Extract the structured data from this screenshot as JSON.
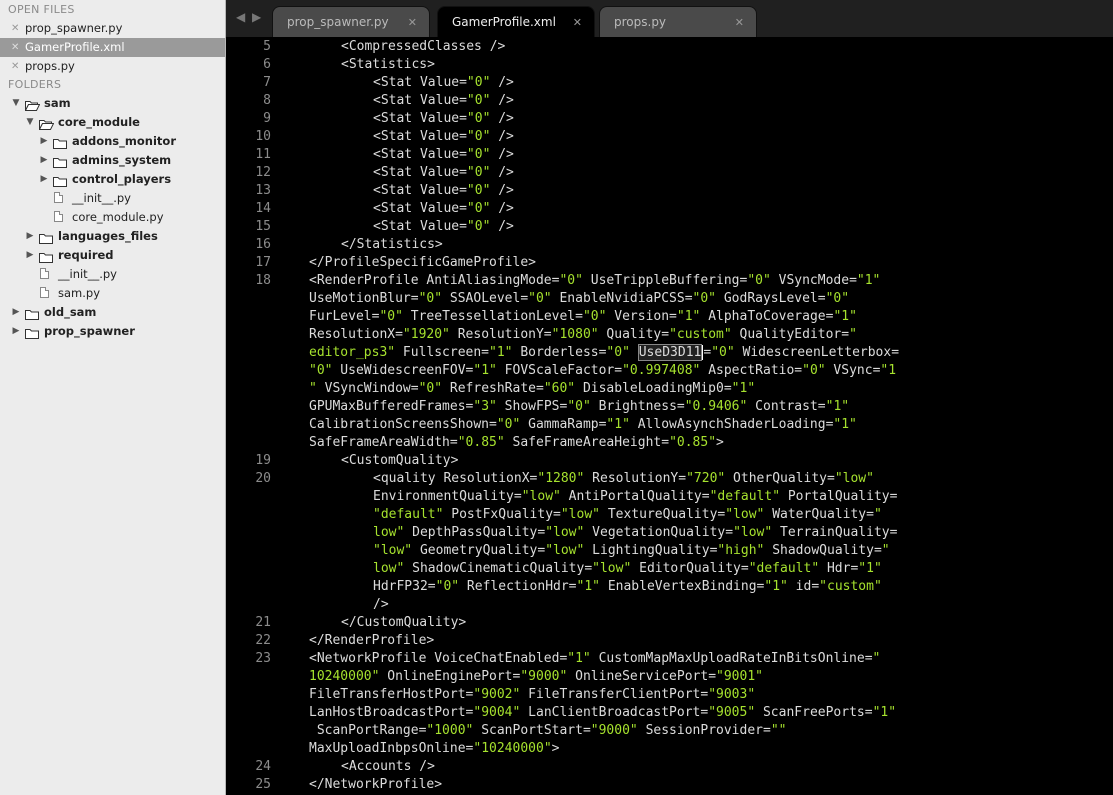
{
  "sidebar": {
    "open_files_header": "OPEN FILES",
    "folders_header": "FOLDERS",
    "open_files": [
      {
        "name": "prop_spawner.py",
        "selected": false
      },
      {
        "name": "GamerProfile.xml",
        "selected": true
      },
      {
        "name": "props.py",
        "selected": false
      }
    ],
    "tree": [
      {
        "label": "sam",
        "kind": "folder",
        "open": true,
        "depth": 0,
        "bold": true
      },
      {
        "label": "core_module",
        "kind": "folder",
        "open": true,
        "depth": 1,
        "bold": true
      },
      {
        "label": "addons_monitor",
        "kind": "folder",
        "open": false,
        "depth": 2,
        "bold": true
      },
      {
        "label": "admins_system",
        "kind": "folder",
        "open": false,
        "depth": 2,
        "bold": true
      },
      {
        "label": "control_players",
        "kind": "folder",
        "open": false,
        "depth": 2,
        "bold": true
      },
      {
        "label": "__init__.py",
        "kind": "file",
        "depth": 2,
        "bold": false
      },
      {
        "label": "core_module.py",
        "kind": "file",
        "depth": 2,
        "bold": false
      },
      {
        "label": "languages_files",
        "kind": "folder",
        "open": false,
        "depth": 1,
        "bold": true
      },
      {
        "label": "required",
        "kind": "folder",
        "open": false,
        "depth": 1,
        "bold": true
      },
      {
        "label": "__init__.py",
        "kind": "file",
        "depth": 1,
        "bold": false
      },
      {
        "label": "sam.py",
        "kind": "file",
        "depth": 1,
        "bold": false
      },
      {
        "label": "old_sam",
        "kind": "folder",
        "open": false,
        "depth": 0,
        "bold": true
      },
      {
        "label": "prop_spawner",
        "kind": "folder",
        "open": false,
        "depth": 0,
        "bold": true
      }
    ]
  },
  "tabs": [
    {
      "label": "prop_spawner.py",
      "active": false,
      "close": "✕"
    },
    {
      "label": "GamerProfile.xml",
      "active": true,
      "close": "✕"
    },
    {
      "label": "props.py",
      "active": false,
      "close": "✕"
    }
  ],
  "colors": {
    "tag": "#dcdcdc",
    "string": "#a6e22e",
    "line_number": "#8c8c8c",
    "background": "#000000"
  },
  "editor": {
    "lines": [
      {
        "n": "5",
        "indent": 2,
        "segs": [
          [
            "t",
            "<CompressedClasses />"
          ]
        ]
      },
      {
        "n": "6",
        "indent": 2,
        "segs": [
          [
            "t",
            "<Statistics>"
          ]
        ]
      },
      {
        "n": "7",
        "indent": 4,
        "segs": [
          [
            "t",
            "<Stat Value="
          ],
          [
            "s",
            "\"0\""
          ],
          [
            "t",
            " />"
          ]
        ]
      },
      {
        "n": "8",
        "indent": 4,
        "segs": [
          [
            "t",
            "<Stat Value="
          ],
          [
            "s",
            "\"0\""
          ],
          [
            "t",
            " />"
          ]
        ]
      },
      {
        "n": "9",
        "indent": 4,
        "segs": [
          [
            "t",
            "<Stat Value="
          ],
          [
            "s",
            "\"0\""
          ],
          [
            "t",
            " />"
          ]
        ]
      },
      {
        "n": "10",
        "indent": 4,
        "segs": [
          [
            "t",
            "<Stat Value="
          ],
          [
            "s",
            "\"0\""
          ],
          [
            "t",
            " />"
          ]
        ]
      },
      {
        "n": "11",
        "indent": 4,
        "segs": [
          [
            "t",
            "<Stat Value="
          ],
          [
            "s",
            "\"0\""
          ],
          [
            "t",
            " />"
          ]
        ]
      },
      {
        "n": "12",
        "indent": 4,
        "segs": [
          [
            "t",
            "<Stat Value="
          ],
          [
            "s",
            "\"0\""
          ],
          [
            "t",
            " />"
          ]
        ]
      },
      {
        "n": "13",
        "indent": 4,
        "segs": [
          [
            "t",
            "<Stat Value="
          ],
          [
            "s",
            "\"0\""
          ],
          [
            "t",
            " />"
          ]
        ]
      },
      {
        "n": "14",
        "indent": 4,
        "segs": [
          [
            "t",
            "<Stat Value="
          ],
          [
            "s",
            "\"0\""
          ],
          [
            "t",
            " />"
          ]
        ]
      },
      {
        "n": "15",
        "indent": 4,
        "segs": [
          [
            "t",
            "<Stat Value="
          ],
          [
            "s",
            "\"0\""
          ],
          [
            "t",
            " />"
          ]
        ]
      },
      {
        "n": "16",
        "indent": 2,
        "segs": [
          [
            "t",
            "</Statistics>"
          ]
        ]
      },
      {
        "n": "17",
        "indent": 0,
        "segs": [
          [
            "t",
            "</ProfileSpecificGameProfile>"
          ]
        ]
      },
      {
        "n": "18",
        "indent": 0,
        "current": true,
        "segs": [
          [
            "t",
            "<RenderProfile AntiAliasingMode="
          ],
          [
            "s",
            "\"0\""
          ],
          [
            "t",
            " UseTrippleBuffering="
          ],
          [
            "s",
            "\"0\""
          ],
          [
            "t",
            " VSyncMode="
          ],
          [
            "s",
            "\"1\""
          ]
        ]
      },
      {
        "n": "",
        "indent": 0,
        "current": true,
        "segs": [
          [
            "t",
            "UseMotionBlur="
          ],
          [
            "s",
            "\"0\""
          ],
          [
            "t",
            " SSAOLevel="
          ],
          [
            "s",
            "\"0\""
          ],
          [
            "t",
            " EnableNvidiaPCSS="
          ],
          [
            "s",
            "\"0\""
          ],
          [
            "t",
            " GodRaysLevel="
          ],
          [
            "s",
            "\"0\""
          ]
        ]
      },
      {
        "n": "",
        "indent": 0,
        "current": true,
        "segs": [
          [
            "t",
            "FurLevel="
          ],
          [
            "s",
            "\"0\""
          ],
          [
            "t",
            " TreeTessellationLevel="
          ],
          [
            "s",
            "\"0\""
          ],
          [
            "t",
            " Version="
          ],
          [
            "s",
            "\"1\""
          ],
          [
            "t",
            " AlphaToCoverage="
          ],
          [
            "s",
            "\"1\""
          ]
        ]
      },
      {
        "n": "",
        "indent": 0,
        "current": true,
        "segs": [
          [
            "t",
            "ResolutionX="
          ],
          [
            "s",
            "\"1920\""
          ],
          [
            "t",
            " ResolutionY="
          ],
          [
            "s",
            "\"1080\""
          ],
          [
            "t",
            " Quality="
          ],
          [
            "s",
            "\"custom\""
          ],
          [
            "t",
            " QualityEditor="
          ],
          [
            "s",
            "\""
          ]
        ]
      },
      {
        "n": "",
        "indent": 0,
        "current": true,
        "segs": [
          [
            "s",
            "editor_ps3\""
          ],
          [
            "t",
            " Fullscreen="
          ],
          [
            "s",
            "\"1\""
          ],
          [
            "t",
            " Borderless="
          ],
          [
            "s",
            "\"0\""
          ],
          [
            "t",
            " "
          ],
          [
            "h",
            "UseD3D11"
          ],
          [
            "c",
            ""
          ],
          [
            "t",
            "="
          ],
          [
            "s",
            "\"0\""
          ],
          [
            "t",
            " WidescreenLetterbox="
          ]
        ]
      },
      {
        "n": "",
        "indent": 0,
        "current": true,
        "segs": [
          [
            "s",
            "\"0\""
          ],
          [
            "t",
            " UseWidescreenFOV="
          ],
          [
            "s",
            "\"1\""
          ],
          [
            "t",
            " FOVScaleFactor="
          ],
          [
            "s",
            "\"0.997408\""
          ],
          [
            "t",
            " AspectRatio="
          ],
          [
            "s",
            "\"0\""
          ],
          [
            "t",
            " VSync="
          ],
          [
            "s",
            "\"1"
          ]
        ]
      },
      {
        "n": "",
        "indent": 0,
        "current": true,
        "segs": [
          [
            "s",
            "\""
          ],
          [
            "t",
            " VSyncWindow="
          ],
          [
            "s",
            "\"0\""
          ],
          [
            "t",
            " RefreshRate="
          ],
          [
            "s",
            "\"60\""
          ],
          [
            "t",
            " DisableLoadingMip0="
          ],
          [
            "s",
            "\"1\""
          ]
        ]
      },
      {
        "n": "",
        "indent": 0,
        "current": true,
        "segs": [
          [
            "t",
            "GPUMaxBufferedFrames="
          ],
          [
            "s",
            "\"3\""
          ],
          [
            "t",
            " ShowFPS="
          ],
          [
            "s",
            "\"0\""
          ],
          [
            "t",
            " Brightness="
          ],
          [
            "s",
            "\"0.9406\""
          ],
          [
            "t",
            " Contrast="
          ],
          [
            "s",
            "\"1\""
          ]
        ]
      },
      {
        "n": "",
        "indent": 0,
        "current": true,
        "segs": [
          [
            "t",
            "CalibrationScreensShown="
          ],
          [
            "s",
            "\"0\""
          ],
          [
            "t",
            " GammaRamp="
          ],
          [
            "s",
            "\"1\""
          ],
          [
            "t",
            " AllowAsynchShaderLoading="
          ],
          [
            "s",
            "\"1\""
          ]
        ]
      },
      {
        "n": "",
        "indent": 0,
        "current": true,
        "segs": [
          [
            "t",
            "SafeFrameAreaWidth="
          ],
          [
            "s",
            "\"0.85\""
          ],
          [
            "t",
            " SafeFrameAreaHeight="
          ],
          [
            "s",
            "\"0.85\""
          ],
          [
            "t",
            ">"
          ]
        ]
      },
      {
        "n": "19",
        "indent": 2,
        "segs": [
          [
            "t",
            "<CustomQuality>"
          ]
        ]
      },
      {
        "n": "20",
        "indent": 4,
        "segs": [
          [
            "t",
            "<quality ResolutionX="
          ],
          [
            "s",
            "\"1280\""
          ],
          [
            "t",
            " ResolutionY="
          ],
          [
            "s",
            "\"720\""
          ],
          [
            "t",
            " OtherQuality="
          ],
          [
            "s",
            "\"low\""
          ]
        ]
      },
      {
        "n": "",
        "indent": 4,
        "segs": [
          [
            "t",
            "EnvironmentQuality="
          ],
          [
            "s",
            "\"low\""
          ],
          [
            "t",
            " AntiPortalQuality="
          ],
          [
            "s",
            "\"default\""
          ],
          [
            "t",
            " PortalQuality="
          ]
        ]
      },
      {
        "n": "",
        "indent": 4,
        "segs": [
          [
            "s",
            "\"default\""
          ],
          [
            "t",
            " PostFxQuality="
          ],
          [
            "s",
            "\"low\""
          ],
          [
            "t",
            " TextureQuality="
          ],
          [
            "s",
            "\"low\""
          ],
          [
            "t",
            " WaterQuality="
          ],
          [
            "s",
            "\""
          ]
        ]
      },
      {
        "n": "",
        "indent": 4,
        "segs": [
          [
            "s",
            "low\""
          ],
          [
            "t",
            " DepthPassQuality="
          ],
          [
            "s",
            "\"low\""
          ],
          [
            "t",
            " VegetationQuality="
          ],
          [
            "s",
            "\"low\""
          ],
          [
            "t",
            " TerrainQuality="
          ]
        ]
      },
      {
        "n": "",
        "indent": 4,
        "segs": [
          [
            "s",
            "\"low\""
          ],
          [
            "t",
            " GeometryQuality="
          ],
          [
            "s",
            "\"low\""
          ],
          [
            "t",
            " LightingQuality="
          ],
          [
            "s",
            "\"high\""
          ],
          [
            "t",
            " ShadowQuality="
          ],
          [
            "s",
            "\""
          ]
        ]
      },
      {
        "n": "",
        "indent": 4,
        "segs": [
          [
            "s",
            "low\""
          ],
          [
            "t",
            " ShadowCinematicQuality="
          ],
          [
            "s",
            "\"low\""
          ],
          [
            "t",
            " EditorQuality="
          ],
          [
            "s",
            "\"default\""
          ],
          [
            "t",
            " Hdr="
          ],
          [
            "s",
            "\"1\""
          ]
        ]
      },
      {
        "n": "",
        "indent": 4,
        "segs": [
          [
            "t",
            "HdrFP32="
          ],
          [
            "s",
            "\"0\""
          ],
          [
            "t",
            " ReflectionHdr="
          ],
          [
            "s",
            "\"1\""
          ],
          [
            "t",
            " EnableVertexBinding="
          ],
          [
            "s",
            "\"1\""
          ],
          [
            "t",
            " id="
          ],
          [
            "s",
            "\"custom\""
          ]
        ]
      },
      {
        "n": "",
        "indent": 4,
        "segs": [
          [
            "t",
            "/>"
          ]
        ]
      },
      {
        "n": "21",
        "indent": 2,
        "segs": [
          [
            "t",
            "</CustomQuality>"
          ]
        ]
      },
      {
        "n": "22",
        "indent": 0,
        "segs": [
          [
            "t",
            "</RenderProfile>"
          ]
        ]
      },
      {
        "n": "23",
        "indent": 0,
        "segs": [
          [
            "t",
            "<NetworkProfile VoiceChatEnabled="
          ],
          [
            "s",
            "\"1\""
          ],
          [
            "t",
            " CustomMapMaxUploadRateInBitsOnline="
          ],
          [
            "s",
            "\""
          ]
        ]
      },
      {
        "n": "",
        "indent": 0,
        "segs": [
          [
            "s",
            "10240000\""
          ],
          [
            "t",
            " OnlineEnginePort="
          ],
          [
            "s",
            "\"9000\""
          ],
          [
            "t",
            " OnlineServicePort="
          ],
          [
            "s",
            "\"9001\""
          ]
        ]
      },
      {
        "n": "",
        "indent": 0,
        "segs": [
          [
            "t",
            "FileTransferHostPort="
          ],
          [
            "s",
            "\"9002\""
          ],
          [
            "t",
            " FileTransferClientPort="
          ],
          [
            "s",
            "\"9003\""
          ]
        ]
      },
      {
        "n": "",
        "indent": 0,
        "segs": [
          [
            "t",
            "LanHostBroadcastPort="
          ],
          [
            "s",
            "\"9004\""
          ],
          [
            "t",
            " LanClientBroadcastPort="
          ],
          [
            "s",
            "\"9005\""
          ],
          [
            "t",
            " ScanFreePorts="
          ],
          [
            "s",
            "\"1\""
          ]
        ]
      },
      {
        "n": "",
        "indent": 0,
        "segs": [
          [
            "t",
            " ScanPortRange="
          ],
          [
            "s",
            "\"1000\""
          ],
          [
            "t",
            " ScanPortStart="
          ],
          [
            "s",
            "\"9000\""
          ],
          [
            "t",
            " SessionProvider="
          ],
          [
            "s",
            "\"\""
          ]
        ]
      },
      {
        "n": "",
        "indent": 0,
        "segs": [
          [
            "t",
            "MaxUploadInbpsOnline="
          ],
          [
            "s",
            "\"10240000\""
          ],
          [
            "t",
            ">"
          ]
        ]
      },
      {
        "n": "24",
        "indent": 2,
        "segs": [
          [
            "t",
            "<Accounts />"
          ]
        ]
      },
      {
        "n": "25",
        "indent": 0,
        "segs": [
          [
            "t",
            "</NetworkProfile>"
          ]
        ]
      }
    ]
  }
}
